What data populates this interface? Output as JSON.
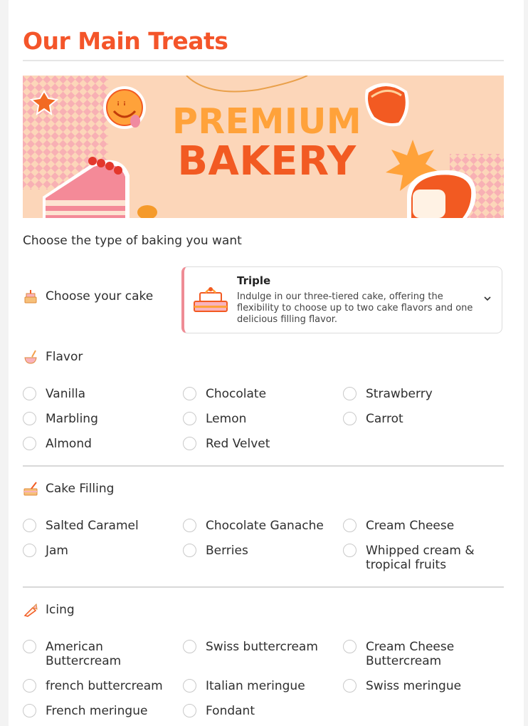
{
  "page": {
    "title": "Our Main Treats",
    "banner": {
      "line1": "PREMIUM",
      "line2": "BAKERY"
    },
    "intro": "Choose the type of baking you want"
  },
  "cake": {
    "label": "Choose your cake",
    "selected_title": "Triple",
    "selected_description": "Indulge in our three-tiered cake, offering the flexibility to choose up to two cake flavors and one delicious filling flavor."
  },
  "flavor": {
    "label": "Flavor",
    "options": [
      "Vanilla",
      "Chocolate",
      "Strawberry",
      "Marbling",
      "Lemon",
      "Carrot",
      "Almond",
      "Red Velvet"
    ]
  },
  "filling": {
    "label": "Cake Filling",
    "options": [
      "Salted Caramel",
      "Chocolate Ganache",
      "Cream Cheese",
      "Jam",
      "Berries",
      "Whipped cream & tropical fruits"
    ]
  },
  "icing": {
    "label": "Icing",
    "options": [
      "American Buttercream",
      "Swiss buttercream",
      "Cream Cheese Buttercream",
      "french buttercream",
      "Italian meringue",
      "Swiss meringue",
      "French meringue",
      "Fondant"
    ]
  },
  "colors": {
    "accent": "#f4552a",
    "banner_bg": "#fcd6b9",
    "select_border": "#ef8c95"
  },
  "icons": {
    "cake": "cake-icon",
    "flavor": "mixing-bowl-icon",
    "filling": "filling-icon",
    "icing": "piping-bag-icon"
  }
}
